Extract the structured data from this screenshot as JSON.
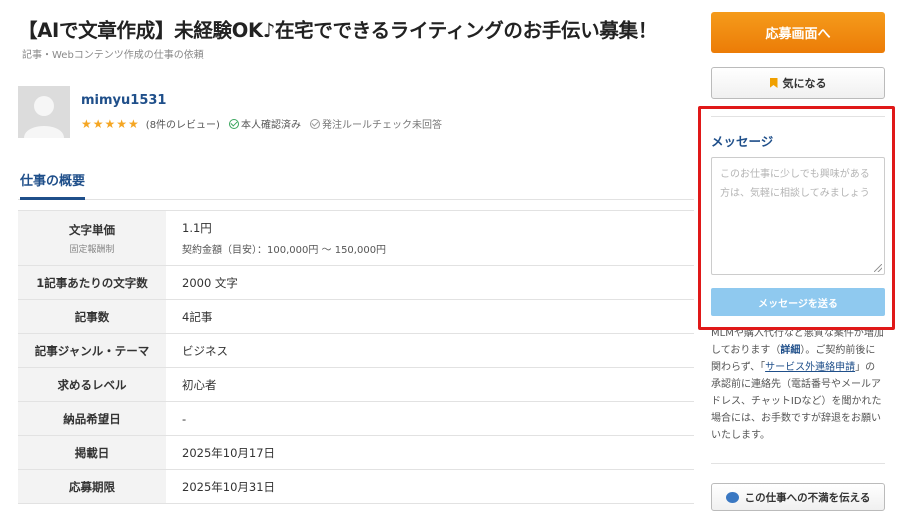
{
  "job": {
    "title": "【AIで文章作成】未経験OK♪在宅でできるライティングのお手伝い募集！",
    "breadcrumb": "記事・Webコンテンツ作成の仕事の依頼"
  },
  "client": {
    "name": "mimyu1531",
    "stars": "★★★★★",
    "reviews": "(8件のレビュー)",
    "verified": "本人確認済み",
    "rule_check": "発注ルールチェック未回答"
  },
  "overview": {
    "title": "仕事の概要",
    "rows": [
      {
        "label": "文字単価",
        "sub_label": "固定報酬制",
        "value": "1.1円",
        "sub_value": "契約金額（目安）：100,000円 〜 150,000円"
      },
      {
        "label": "1記事あたりの文字数",
        "value": "2000 文字"
      },
      {
        "label": "記事数",
        "value": "4記事"
      },
      {
        "label": "記事ジャンル・テーマ",
        "value": "ビジネス"
      },
      {
        "label": "求めるレベル",
        "value": "初心者"
      },
      {
        "label": "納品希望日",
        "value": "-"
      },
      {
        "label": "掲載日",
        "value": "2025年10月17日"
      },
      {
        "label": "応募期限",
        "value": "2025年10月31日"
      }
    ]
  },
  "sidebar": {
    "apply_label": "応募画面へ",
    "favorite_label": "気になる",
    "message_title": "メッセージ",
    "message_placeholder": "このお仕事に少しでも興味がある方は、気軽に相談してみましょう",
    "send_label": "メッセージを送る",
    "notice_part1": "MLMや購入代行など悪質な案件が増加しております（",
    "notice_detail": "詳細",
    "notice_part2": "）。ご契約前後に関わらず、「",
    "notice_link": "サービス外連絡申請",
    "notice_part3": "」の承認前に連絡先（電話番号やメールアドレス、チャットIDなど）を聞かれた場合には、お手数ですが辞退をお願いいたします。",
    "report_label": "この仕事への不満を伝える"
  },
  "colors": {
    "accent_orange": "#ec7c07",
    "link_blue": "#1f4f8a",
    "highlight_red": "#e01818",
    "send_button": "#8fc9ef"
  }
}
